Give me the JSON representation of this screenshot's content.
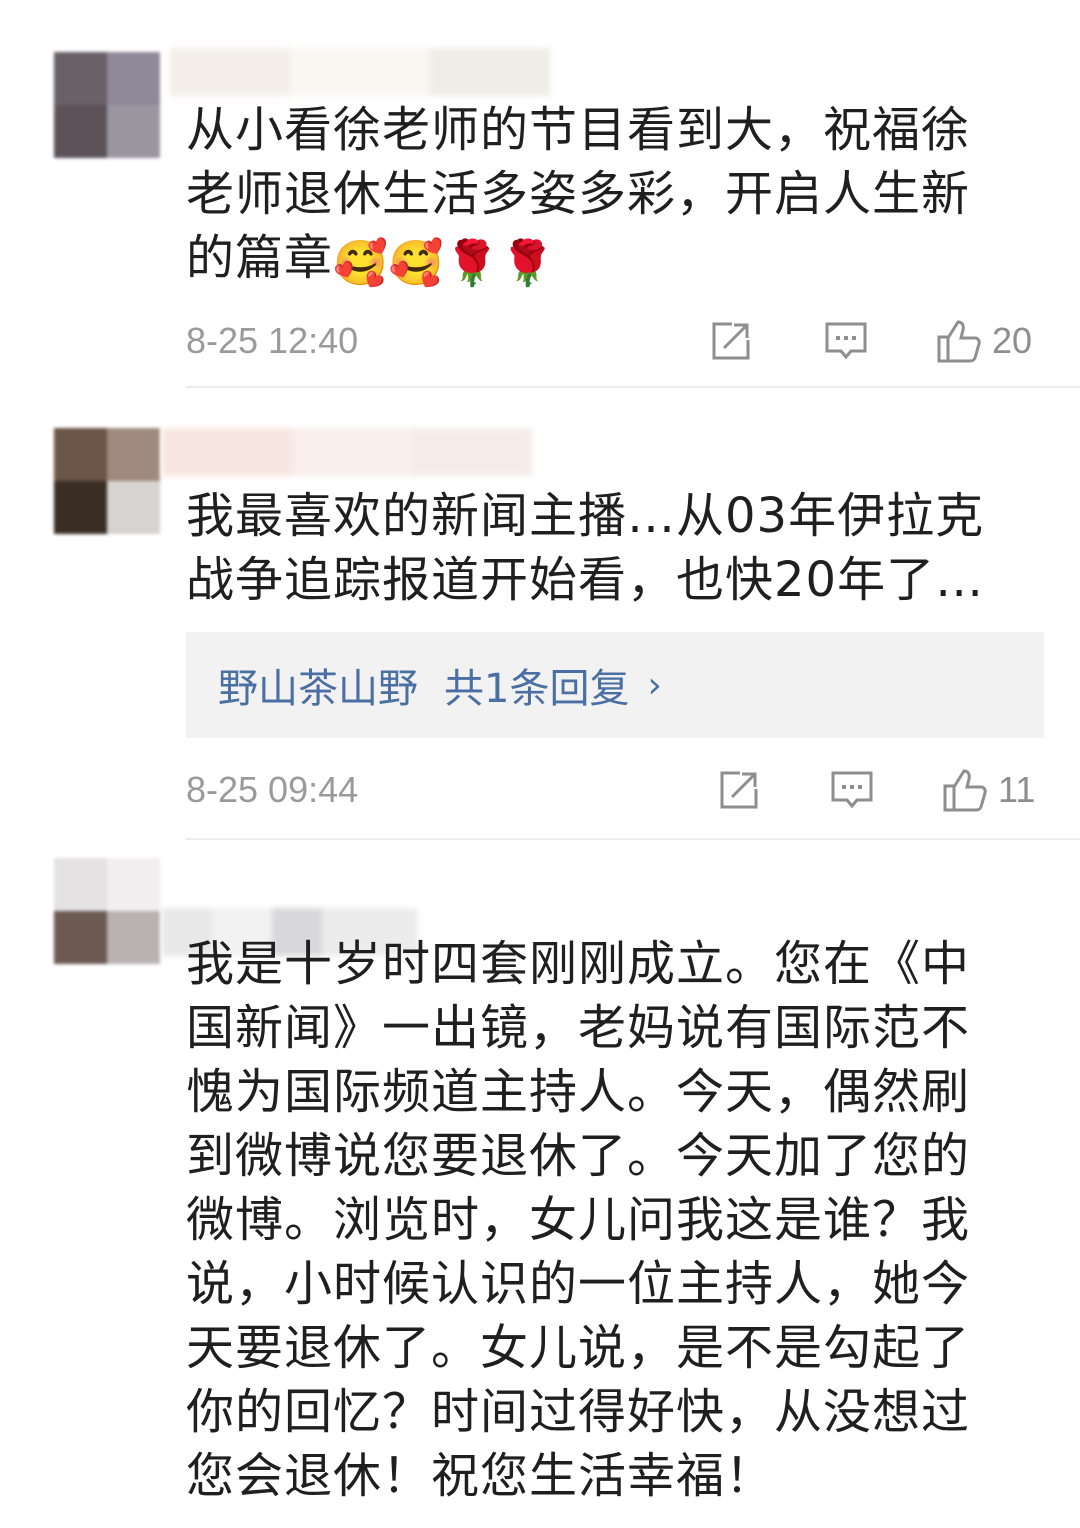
{
  "comments": [
    {
      "text_lines": [
        "从小看徐老师的节目看到大，祝福徐",
        "老师退休生活多姿多彩，开启人生新",
        "的篇章"
      ],
      "emojis": [
        "🥰",
        "🥰",
        "🌹",
        "🌹"
      ],
      "time": "8-25 12:40",
      "likes": "20"
    },
    {
      "text_lines": [
        "我最喜欢的新闻主播…从03年伊拉克",
        "战争追踪报道开始看，也快20年了…"
      ],
      "reply": {
        "name": "野山茶山野",
        "count_label": "共1条回复",
        "chevron": "›"
      },
      "time": "8-25 09:44",
      "likes": "11"
    },
    {
      "text_lines": [
        "我是十岁时四套刚刚成立。您在《中",
        "国新闻》一出镜，老妈说有国际范不",
        "愧为国际频道主持人。今天，偶然刷",
        "到微博说您要退休了。今天加了您的",
        "微博。浏览时，女儿问我这是谁？我",
        "说，小时候认识的一位主持人，她今",
        "天要退休了。女儿说，是不是勾起了",
        "你的回忆？时间过得好快，从没想过",
        "您会退休！祝您生活幸福！"
      ]
    }
  ],
  "icons": {
    "share": "share-icon",
    "comment": "comment-icon",
    "like": "thumbs-up-icon"
  },
  "colors": {
    "text": "#1f1f1f",
    "meta": "#9a9a9a",
    "link": "#4a6fa3",
    "reply_bg": "#f2f2f2"
  }
}
